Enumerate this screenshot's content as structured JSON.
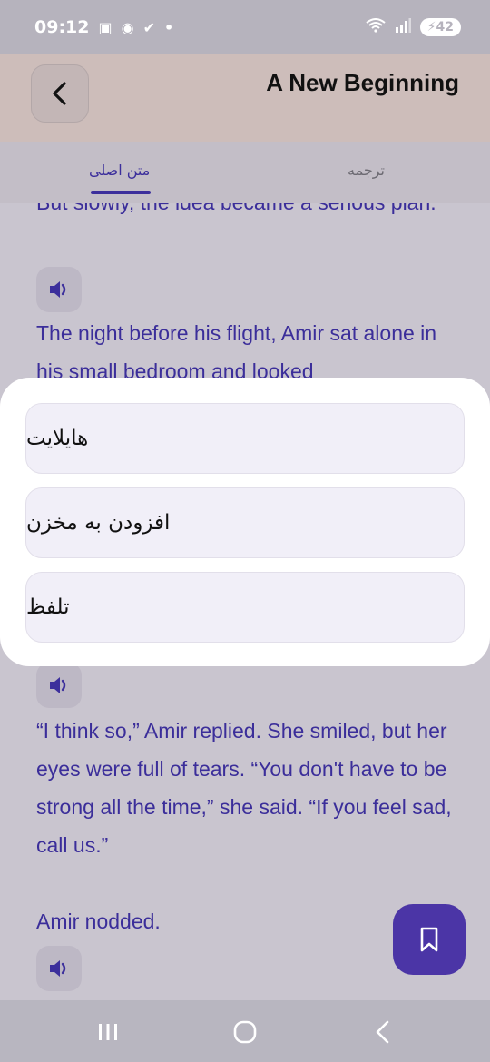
{
  "status_bar": {
    "time": "09:12",
    "icons_left": [
      "screenshot-icon",
      "badge-icon",
      "shield-check-icon",
      "dot-icon"
    ],
    "icons_right": [
      "wifi-icon",
      "signal-icon"
    ],
    "battery": "42"
  },
  "header": {
    "title": "A New Beginning",
    "back_icon": "chevron-left-icon"
  },
  "tabs": [
    {
      "label": "متن اصلی",
      "active": true
    },
    {
      "label": "ترجمه",
      "active": false
    }
  ],
  "content": {
    "paragraphs": [
      "But slowly, the idea became a serious plan.",
      "The night before his flight, Amir sat alone in his small bedroom and looked",
      "“I think so,” Amir replied. She smiled, but her eyes were full of tears. “You don't have to be strong all the time,” she said. “If you feel sad, call us.”",
      "Amir nodded."
    ],
    "speaker_icon": "speaker-icon"
  },
  "sheet": {
    "options": [
      {
        "label": "هایلایت"
      },
      {
        "label": "افزودن به مخزن"
      },
      {
        "label": "تلفظ"
      }
    ]
  },
  "fab": {
    "icon": "bookmark-icon"
  },
  "navbar": {
    "icons": [
      "recents-icon",
      "home-icon",
      "back-icon"
    ]
  },
  "colors": {
    "accent": "#4b35a6",
    "text": "#3b2e9a"
  }
}
